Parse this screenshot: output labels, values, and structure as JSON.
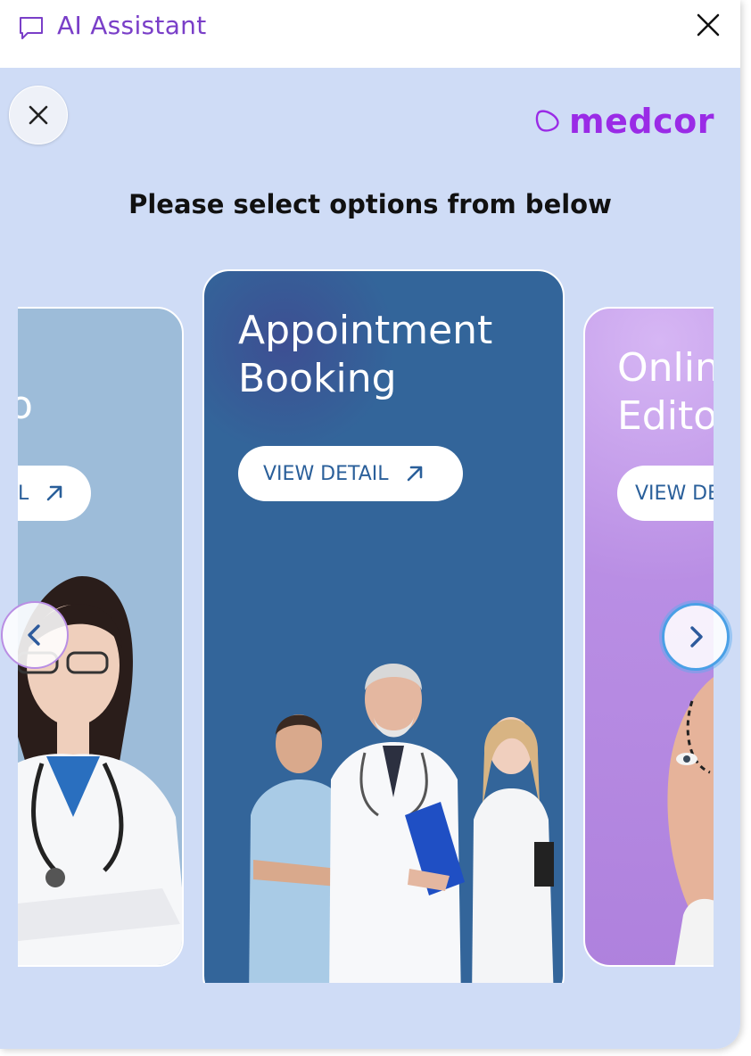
{
  "header": {
    "title": "AI Assistant"
  },
  "logo": {
    "text": "medcor"
  },
  "main": {
    "heading": "Please select options from below"
  },
  "cards": [
    {
      "title": "o",
      "button_label": "L"
    },
    {
      "title": "Appointment\nBooking",
      "button_label": "VIEW DETAIL"
    },
    {
      "title": "Onlin\nEditor",
      "button_label": "VIEW DE"
    }
  ],
  "colors": {
    "accent": "#7a3fc8",
    "logo": "#9a2be6",
    "content_bg": "#cfdcf6",
    "card_center": "#33659a",
    "card_left": "#9dbcd9",
    "card_right": "#b98ee4"
  }
}
